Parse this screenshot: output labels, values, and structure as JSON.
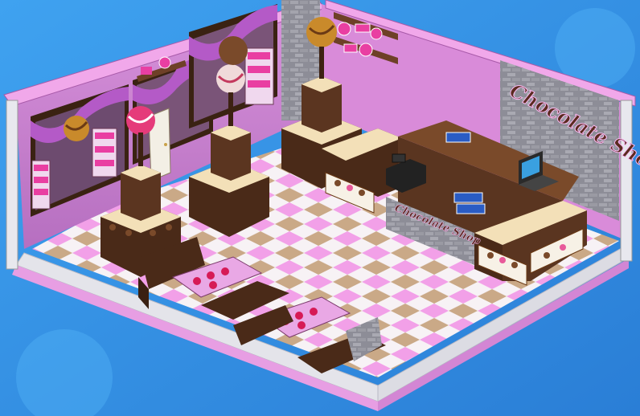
{
  "scene": {
    "wall_sign": "Chocolate Shop",
    "counter_sign": "Chocolate Shop"
  },
  "colors": {
    "background": "#2f8fe0",
    "wall_pink": "#c77bd0",
    "trim_pink": "#f1a8ea",
    "brick_gray": "#8d8d97",
    "chocolate": "#4a2a18",
    "cream": "#f3e0b8",
    "floor_pink": "#f2a0e8",
    "floor_tan": "#caa987",
    "floor_white": "#f7f2f5",
    "truffle_gold": "#c98a2b"
  },
  "icons": {
    "cash_register": "cash-register-icon",
    "laptop": "laptop-icon"
  }
}
